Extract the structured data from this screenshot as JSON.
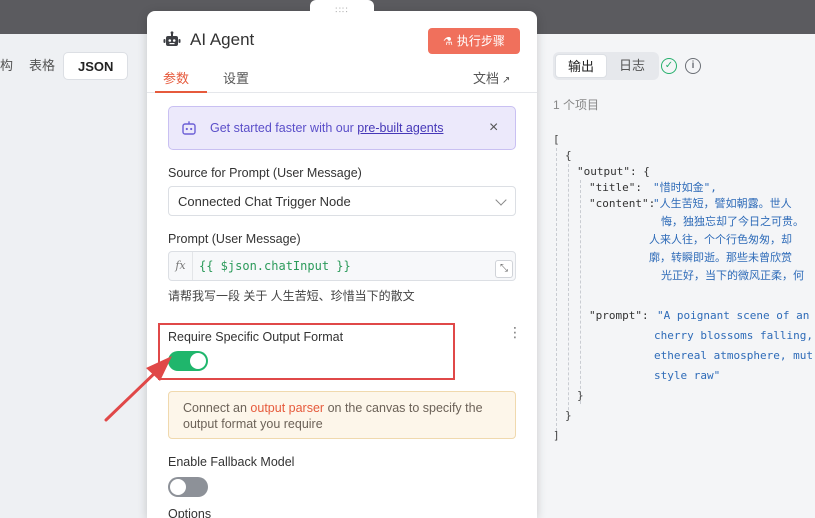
{
  "left": {
    "tabs": [
      {
        "label": "构"
      },
      {
        "label": "表格"
      },
      {
        "label": "JSON"
      }
    ]
  },
  "right": {
    "tabs": [
      {
        "label": "输出"
      },
      {
        "label": "日志"
      }
    ],
    "item_count": "1 个项目",
    "json_lines": {
      "open_bracket": "[",
      "open_brace": "{",
      "output_key": "\"output\": {",
      "title_key": "\"title\":",
      "title_val": "\"惜时如金\",",
      "content_key": "\"content\":",
      "content_l1": "\"人生苦短，譬如朝露。世人",
      "content_l2": "悔，独独忘却了今日之可贵。",
      "content_l3": "人来人往，个个行色匆匆，却",
      "content_l4": "廓，转瞬即逝。那些未曾欣赏",
      "content_l5": "光正好，当下的微风正柔，何",
      "prompt_key": "\"prompt\":",
      "prompt_l1": "\"A poignant scene of an",
      "prompt_l2": "cherry blossoms falling,",
      "prompt_l3": "ethereal atmosphere, mut",
      "prompt_l4": "style raw\"",
      "close_inner": "}",
      "close_brace": "}",
      "close_bracket": "]"
    }
  },
  "modal": {
    "drag_handle": "∷∷",
    "title": "AI Agent",
    "exec_button": "执行步骤",
    "tabs": [
      {
        "label": "参数"
      },
      {
        "label": "设置"
      }
    ],
    "docs_link": "文档",
    "callout": {
      "prefix": "Get started faster with our ",
      "link": "pre-built agents"
    },
    "source_label": "Source for Prompt (User Message)",
    "source_value": "Connected Chat Trigger Node",
    "prompt_label": "Prompt (User Message)",
    "prompt_expression": "{{ $json.chatInput }}",
    "prompt_hint": "请帮我写一段 关于 人生苦短、珍惜当下的散文",
    "require_output_label": "Require Specific Output Format",
    "require_output_enabled": true,
    "warning": {
      "prefix": "Connect an ",
      "link": "output parser",
      "suffix": " on the canvas to specify the output format you require"
    },
    "fallback_label": "Enable Fallback Model",
    "fallback_enabled": false,
    "options_label": "Options"
  },
  "colors": {
    "accent": "#e65a3c",
    "exec_button": "#f0705c",
    "toggle_on": "#1fb66c",
    "toggle_off": "#8d9198",
    "annotation_red": "#e04848"
  }
}
